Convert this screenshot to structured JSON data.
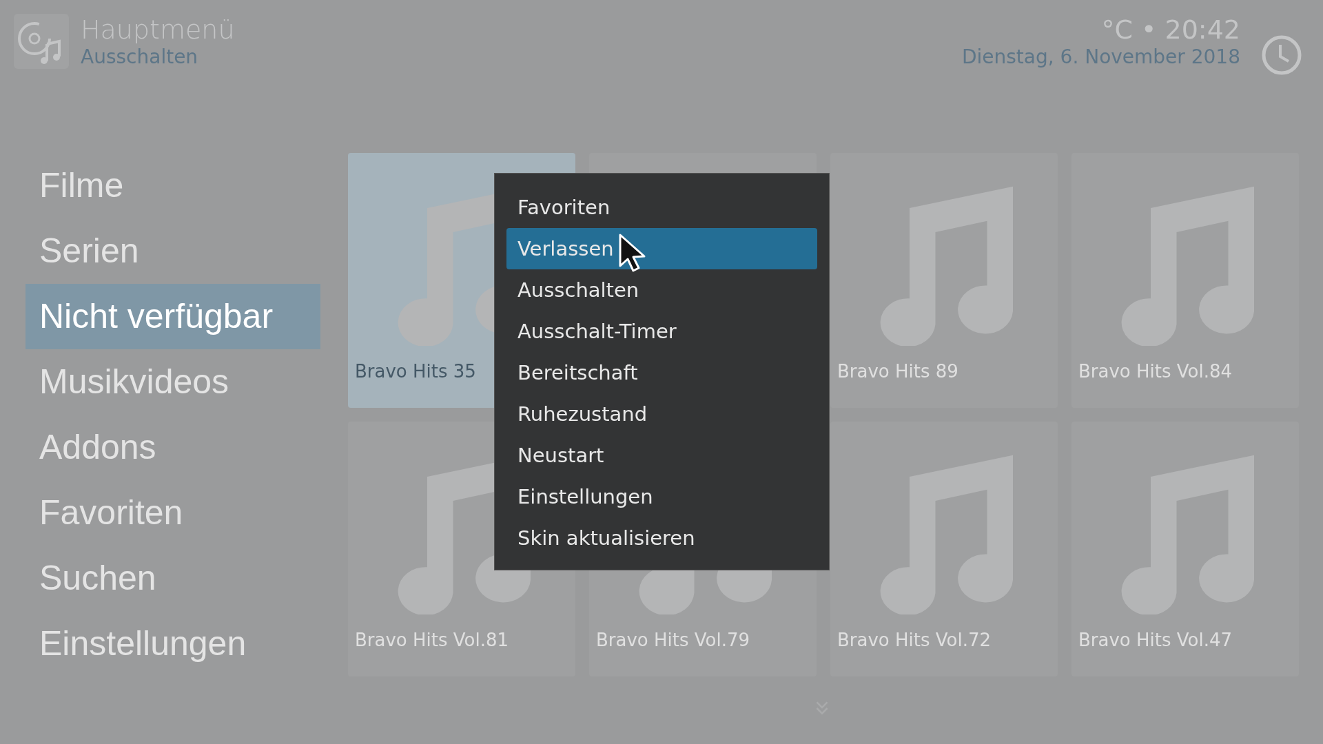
{
  "header": {
    "title": "Hauptmenü",
    "subtitle": "Ausschalten",
    "weather_time": "°C • 20:42",
    "date": "Dienstag, 6. November 2018"
  },
  "sidebar": {
    "items": [
      {
        "label": "Filme",
        "selected": false
      },
      {
        "label": "Serien",
        "selected": false
      },
      {
        "label": "Nicht verfügbar",
        "selected": true
      },
      {
        "label": "Musikvideos",
        "selected": false
      },
      {
        "label": "Addons",
        "selected": false
      },
      {
        "label": "Favoriten",
        "selected": false
      },
      {
        "label": "Suchen",
        "selected": false
      },
      {
        "label": "Einstellungen",
        "selected": false
      }
    ]
  },
  "tiles": [
    {
      "label": "Bravo Hits 35",
      "selected": true
    },
    {
      "selected": false
    },
    {
      "label": "Bravo Hits 89",
      "selected": false
    },
    {
      "label": "Bravo Hits Vol.84",
      "selected": false
    },
    {
      "label": "Bravo Hits Vol.81",
      "selected": false
    },
    {
      "label": "Bravo Hits Vol.79",
      "selected": false
    },
    {
      "label": "Bravo Hits Vol.72",
      "selected": false
    },
    {
      "label": "Bravo Hits Vol.47",
      "selected": false
    }
  ],
  "menu": {
    "items": [
      {
        "label": "Favoriten",
        "selected": false
      },
      {
        "label": "Verlassen",
        "selected": true
      },
      {
        "label": "Ausschalten",
        "selected": false
      },
      {
        "label": "Ausschalt-Timer",
        "selected": false
      },
      {
        "label": "Bereitschaft",
        "selected": false
      },
      {
        "label": "Ruhezustand",
        "selected": false
      },
      {
        "label": "Neustart",
        "selected": false
      },
      {
        "label": "Einstellungen",
        "selected": false
      },
      {
        "label": "Skin aktualisieren",
        "selected": false
      }
    ]
  }
}
